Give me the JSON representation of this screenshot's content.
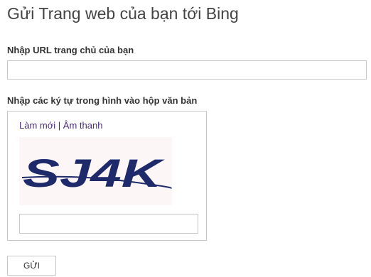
{
  "page": {
    "title": "Gửi Trang web của bạn tới Bing"
  },
  "url_field": {
    "label": "Nhập URL trang chủ của bạn",
    "value": "",
    "placeholder": ""
  },
  "captcha": {
    "label": "Nhập các ký tự trong hình vào hộp văn bản",
    "refresh_link": "Làm mới",
    "separator": "|",
    "audio_link": "Âm thanh",
    "image_text": "SJ4K",
    "input_value": "",
    "input_placeholder": ""
  },
  "actions": {
    "submit_label": "GỬI"
  },
  "colors": {
    "link": "#4a2c7a",
    "captcha_ink": "#1f2a6b",
    "border": "#c8c8c8",
    "title": "#444444"
  }
}
